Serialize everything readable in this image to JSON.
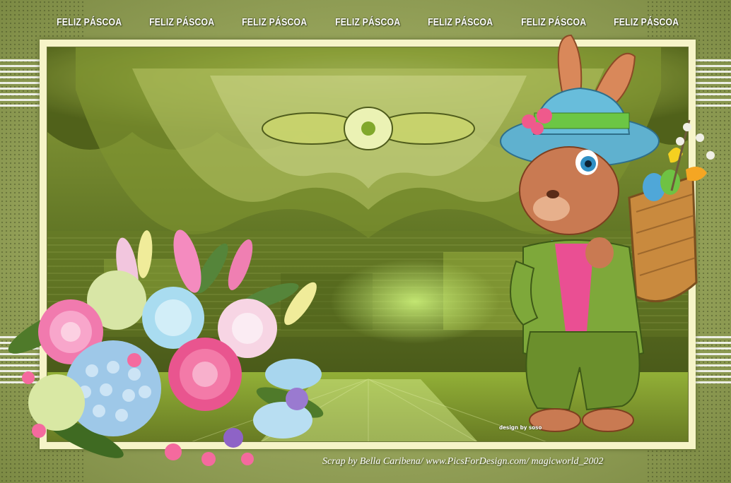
{
  "banner": {
    "items": [
      "FELIZ PÁSCOA",
      "FELIZ PÁSCOA",
      "FELIZ PÁSCOA",
      "FELIZ PÁSCOA",
      "FELIZ PÁSCOA",
      "FELIZ PÁSCOA",
      "FELIZ PÁSCOA"
    ]
  },
  "designer_signature": "design by soso",
  "credit_line": "Scrap by Bella Caribena/ www.PicsForDesign.com/ magicworld_2002",
  "colors": {
    "background_green": "#98a55c",
    "frame_cream": "#f6f4c8",
    "banner_text": "#ffffff"
  }
}
